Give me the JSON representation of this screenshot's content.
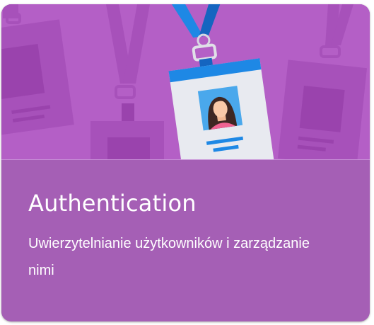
{
  "card": {
    "title": "Authentication",
    "description": "Uwierzytelnianie użytkowników i zarządzanie nimi"
  },
  "colors": {
    "card_background": "#a55fb5",
    "hero_background": "#b45fc6",
    "badge_background": "#e8eaf0",
    "lanyard": "#1e88e5",
    "photo_background": "#4aa8ec",
    "text": "#ffffff"
  },
  "icons": {
    "hero": "id-badge-lanyard-illustration",
    "avatar": "person-avatar-icon"
  }
}
